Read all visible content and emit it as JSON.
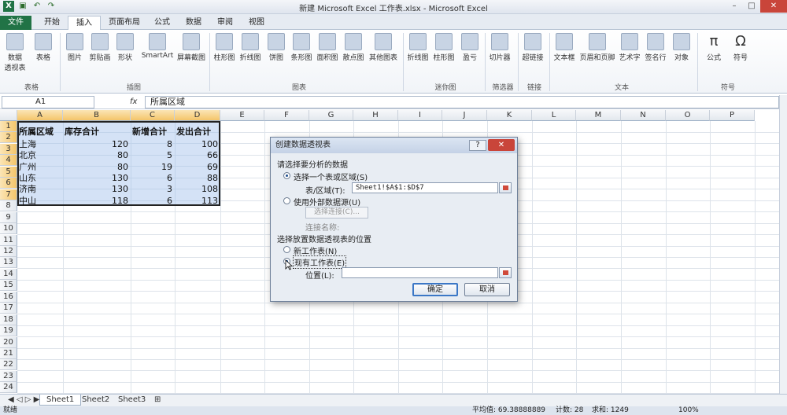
{
  "window": {
    "title": "新建 Microsoft Excel 工作表.xlsx - Microsoft Excel",
    "controls": [
      "–",
      "□",
      "✕"
    ]
  },
  "tabs": [
    "文件",
    "开始",
    "插入",
    "页面布局",
    "公式",
    "数据",
    "审阅",
    "视图"
  ],
  "ribbon": {
    "buttons": [
      {
        "label": "数据\n透视表"
      },
      {
        "label": "表格"
      },
      {
        "label": "图片"
      },
      {
        "label": "剪贴画"
      },
      {
        "label": "形状"
      },
      {
        "label": "SmartArt"
      },
      {
        "label": "屏幕截图"
      },
      {
        "label": "柱形图"
      },
      {
        "label": "折线图"
      },
      {
        "label": "饼图"
      },
      {
        "label": "条形图"
      },
      {
        "label": "面积图"
      },
      {
        "label": "散点图"
      },
      {
        "label": "其他图表"
      },
      {
        "label": "折线图"
      },
      {
        "label": "柱形图"
      },
      {
        "label": "盈亏"
      },
      {
        "label": "切片器"
      },
      {
        "label": "超链接"
      },
      {
        "label": "文本框"
      },
      {
        "label": "页眉和页脚"
      },
      {
        "label": "艺术字"
      },
      {
        "label": "签名行"
      },
      {
        "label": "对象"
      },
      {
        "label": "公式"
      },
      {
        "label": "符号"
      }
    ],
    "groups": [
      "表格",
      "插图",
      "图表",
      "迷你图",
      "筛选器",
      "链接",
      "文本",
      "符号"
    ]
  },
  "formula_bar": {
    "namebox": "A1",
    "fx": "fx",
    "content": "所属区域"
  },
  "columns": [
    "A",
    "B",
    "C",
    "D",
    "E",
    "F",
    "G",
    "H",
    "I",
    "J",
    "K",
    "L",
    "M",
    "N",
    "O",
    "P"
  ],
  "rows": [
    "1",
    "2",
    "3",
    "4",
    "5",
    "6",
    "7",
    "8",
    "9",
    "10",
    "11",
    "12",
    "13",
    "14",
    "15",
    "16",
    "17",
    "18",
    "19",
    "20",
    "21",
    "22",
    "23",
    "24"
  ],
  "table": {
    "headers": [
      "所属区域",
      "库存合计",
      "新增合计",
      "发出合计"
    ],
    "rows": [
      [
        "上海",
        "120",
        "8",
        "100"
      ],
      [
        "北京",
        "80",
        "5",
        "66"
      ],
      [
        "广州",
        "80",
        "19",
        "69"
      ],
      [
        "山东",
        "130",
        "6",
        "88"
      ],
      [
        "济南",
        "130",
        "3",
        "108"
      ],
      [
        "中山",
        "118",
        "6",
        "113"
      ]
    ]
  },
  "sheet_tabs": [
    "Sheet1",
    "Sheet2",
    "Sheet3"
  ],
  "status": {
    "mode": "就绪",
    "average": "平均值: 69.38888889",
    "count": "计数: 28",
    "sum": "求和: 1249",
    "zoom": "100%"
  },
  "dialog": {
    "title": "创建数据透视表",
    "help": "?",
    "close": "✕",
    "section1": "请选择要分析的数据",
    "option_table": "选择一个表或区域(S)",
    "range_label": "表/区域(T):",
    "range_value": "Sheet1!$A$1:$D$7",
    "option_external": "使用外部数据源(U)",
    "choose_connection": "选择连接(C)...",
    "connection_name": "连接名称:",
    "section2": "选择放置数据透视表的位置",
    "option_new": "新工作表(N)",
    "option_existing": "现有工作表(E)",
    "location_label": "位置(L):",
    "location_value": "",
    "ok": "确定",
    "cancel": "取消"
  },
  "colors": {
    "excel_green": "#217346",
    "selection": "#a0beeb",
    "close_red": "#c9453a"
  }
}
